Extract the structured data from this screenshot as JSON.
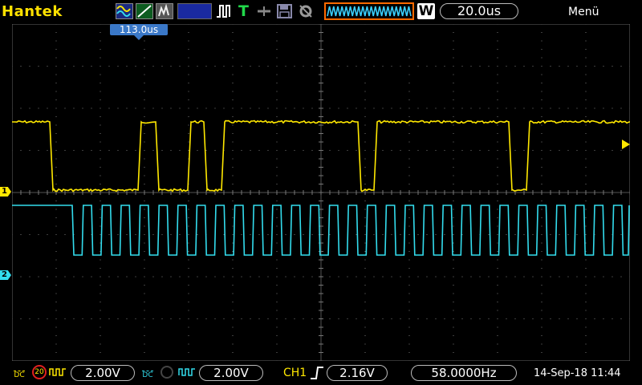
{
  "header": {
    "brand": "Hantek",
    "trigger_letter": "T",
    "timebase_mode_badge": "W",
    "timebase_value": "20.0us",
    "menu_label": "Menü"
  },
  "screen": {
    "trigger_position_label": "113.0us"
  },
  "channels": {
    "ch1": {
      "marker": "1",
      "color": "#ffe800",
      "volts_div": "2.00V",
      "bw_limit_label": "20"
    },
    "ch2": {
      "marker": "2",
      "color": "#33ddee",
      "volts_div": "2.00V"
    }
  },
  "footer": {
    "coupling_dc": "DC",
    "trigger_source": "CH1",
    "trigger_level": "2.16V",
    "frequency": "58.0000Hz",
    "datetime": "14-Sep-18 11:44"
  },
  "icons": [
    "mode-yt-icon",
    "mode-xy-icon",
    "mode-sample-icon",
    "run-stop-icon",
    "trigger-icon",
    "cursor-icon",
    "save-icon",
    "settings-icon",
    "waveform-icon"
  ]
}
